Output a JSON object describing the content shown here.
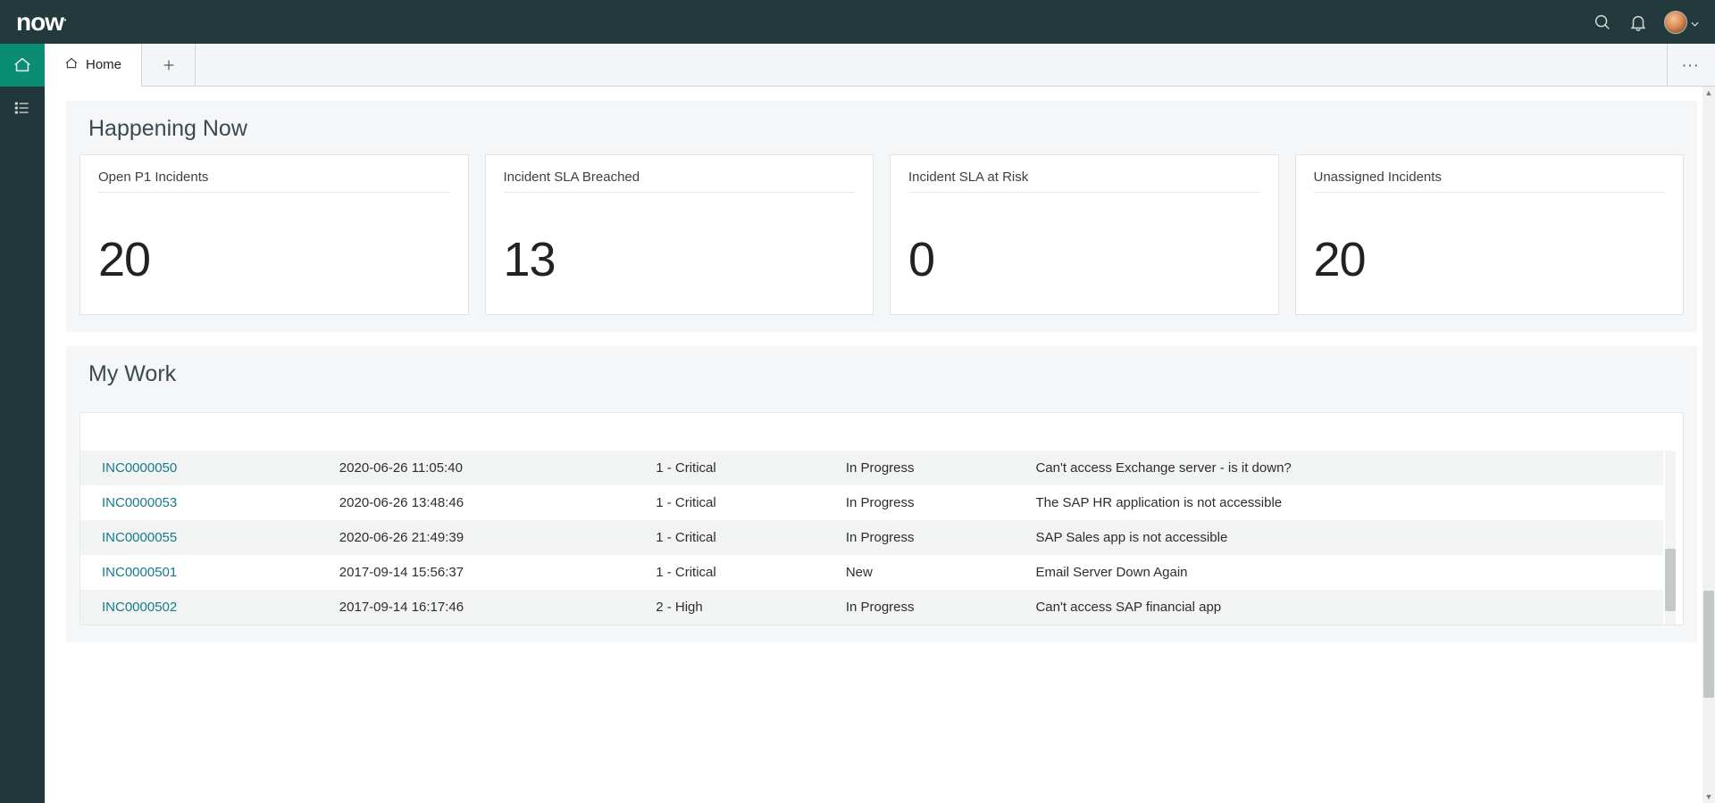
{
  "banner": {
    "logo_main": "now",
    "logo_dot": "."
  },
  "tabs": {
    "home_label": "Home"
  },
  "happening": {
    "title": "Happening Now",
    "cards": [
      {
        "title": "Open P1 Incidents",
        "value": "20"
      },
      {
        "title": "Incident SLA Breached",
        "value": "13"
      },
      {
        "title": "Incident SLA at Risk",
        "value": "0"
      },
      {
        "title": "Unassigned Incidents",
        "value": "20"
      }
    ]
  },
  "mywork": {
    "title": "My Work",
    "rows": [
      {
        "id": "INC0000050",
        "time": "2020-06-26 11:05:40",
        "priority": "1 - Critical",
        "state": "In Progress",
        "desc": "Can't access Exchange server - is it down?"
      },
      {
        "id": "INC0000053",
        "time": "2020-06-26 13:48:46",
        "priority": "1 - Critical",
        "state": "In Progress",
        "desc": "The SAP HR application is not accessible"
      },
      {
        "id": "INC0000055",
        "time": "2020-06-26 21:49:39",
        "priority": "1 - Critical",
        "state": "In Progress",
        "desc": "SAP Sales app is not accessible"
      },
      {
        "id": "INC0000501",
        "time": "2017-09-14 15:56:37",
        "priority": "1 - Critical",
        "state": "New",
        "desc": "Email Server Down Again"
      },
      {
        "id": "INC0000502",
        "time": "2017-09-14 16:17:46",
        "priority": "2 - High",
        "state": "In Progress",
        "desc": "Can't access SAP financial app"
      }
    ]
  }
}
